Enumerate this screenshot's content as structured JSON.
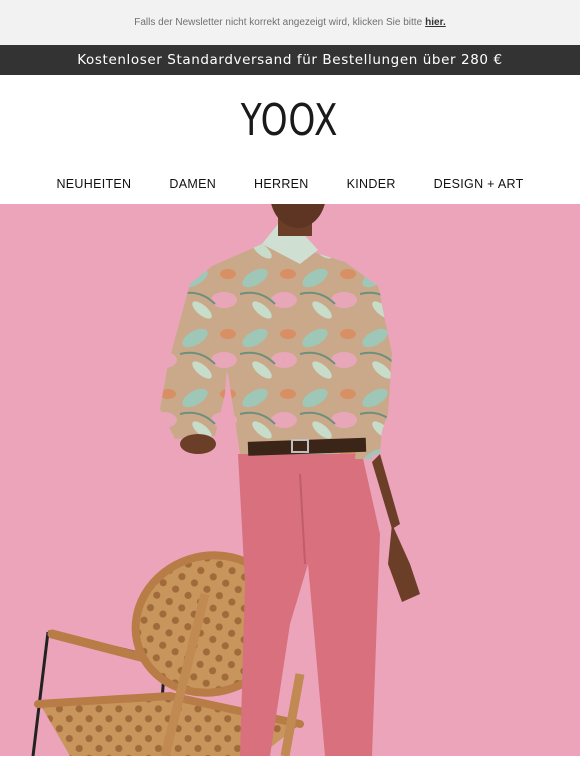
{
  "preheader": {
    "text": "Falls der Newsletter nicht korrekt angezeigt wird, klicken Sie bitte",
    "link_label": "hier."
  },
  "shipping_banner": {
    "text": "Kostenloser Standardversand für Bestellungen über 280 €"
  },
  "logo": {
    "text": "YOOX"
  },
  "nav": {
    "items": [
      {
        "label": "NEUHEITEN"
      },
      {
        "label": "DAMEN"
      },
      {
        "label": "HERREN"
      },
      {
        "label": "KINDER"
      },
      {
        "label": "DESIGN + ART"
      }
    ]
  },
  "colors": {
    "hero_background": "#eca4bb",
    "shipping_bar": "#333333",
    "preheader_bg": "#f2f2f2"
  }
}
